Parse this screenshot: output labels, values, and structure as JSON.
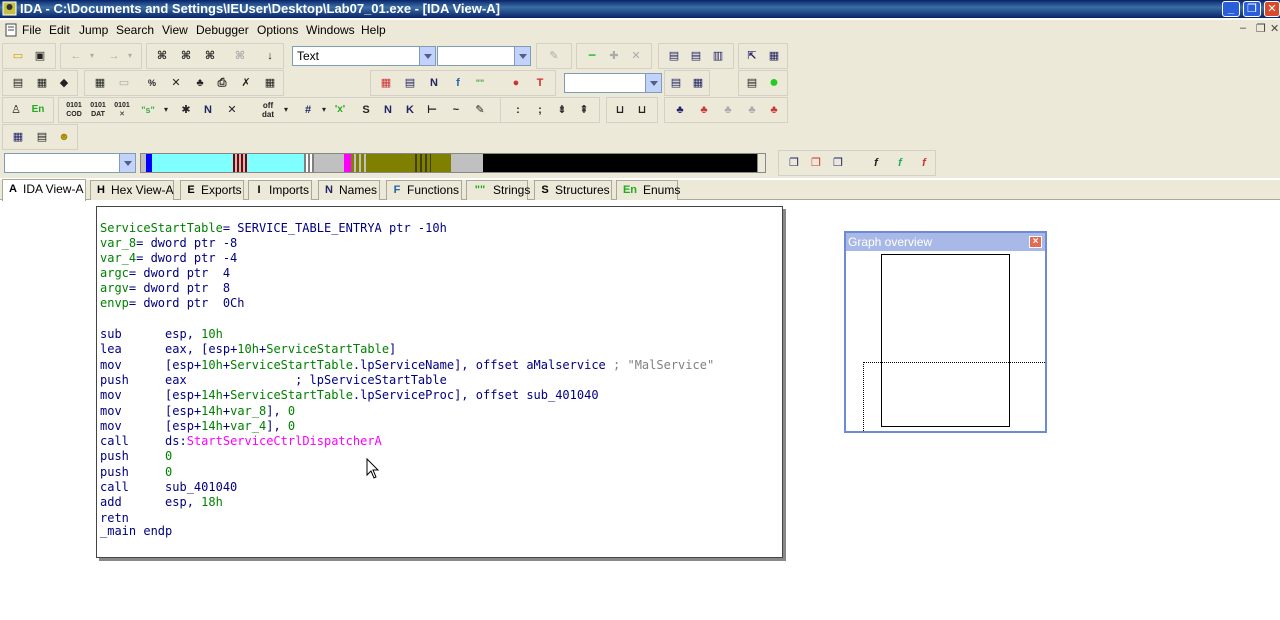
{
  "window": {
    "title": "IDA - C:\\Documents and Settings\\IEUser\\Desktop\\Lab07_01.exe - [IDA View-A]",
    "min_label": "_",
    "max_label": "❐",
    "close_label": "✕"
  },
  "menu": [
    "File",
    "Edit",
    "Jump",
    "Search",
    "View",
    "Debugger",
    "Options",
    "Windows",
    "Help"
  ],
  "menu_window_controls": [
    "–",
    "❐",
    "✕"
  ],
  "toolbar": {
    "display_combo": "Text",
    "second_combo": "",
    "third_combo": "",
    "segment_combo": ""
  },
  "tabs": [
    "IDA View-A",
    "Hex View-A",
    "Exports",
    "Imports",
    "Names",
    "Functions",
    "Strings",
    "Structures",
    "Enums"
  ],
  "tab_icons": [
    "A",
    "H",
    "E",
    "I",
    "N",
    "F",
    "\"\"",
    "S",
    "En"
  ],
  "navband_colors": {
    "cyan": "#7fffff",
    "darkred": "#800000",
    "gray": "#c0c0c0",
    "olive": "#808000",
    "magenta": "#ff00ff",
    "blue": "#0000ff",
    "black": "#000000"
  },
  "code": {
    "lines": [
      [
        "ServiceStartTable",
        "= ",
        "SERVICE_TABLE_ENTRYA ptr -10h"
      ],
      [
        "var_8",
        "= ",
        "dword ptr -8"
      ],
      [
        "var_4",
        "= ",
        "dword ptr -4"
      ],
      [
        "argc",
        "= ",
        "dword ptr  4"
      ],
      [
        "argv",
        "= ",
        "dword ptr  8"
      ],
      [
        "envp",
        "= ",
        "dword ptr  0Ch"
      ]
    ],
    "instructions": [
      {
        "mn": "sub",
        "op": "esp, 10h"
      },
      {
        "mn": "lea",
        "op": "eax, [esp+10h+ServiceStartTable]"
      },
      {
        "mn": "mov",
        "op": "[esp+10h+ServiceStartTable.lpServiceName], offset aMalservice",
        "cmt": "; \"MalService\""
      },
      {
        "mn": "push",
        "op": "eax",
        "cmt": "; lpServiceStartTable"
      },
      {
        "mn": "mov",
        "op": "[esp+14h+ServiceStartTable.lpServiceProc], offset sub_401040"
      },
      {
        "mn": "mov",
        "op": "[esp+14h+var_8], 0"
      },
      {
        "mn": "mov",
        "op": "[esp+14h+var_4], 0"
      },
      {
        "mn": "call",
        "op": "ds:StartServiceCtrlDispatcherA"
      },
      {
        "mn": "push",
        "op": "0"
      },
      {
        "mn": "push",
        "op": "0"
      },
      {
        "mn": "call",
        "op": "sub_401040"
      },
      {
        "mn": "add",
        "op": "esp, 18h"
      },
      {
        "mn": "retn",
        "op": ""
      }
    ],
    "endp": "_main endp"
  },
  "graph_overview": {
    "title": "Graph overview",
    "close": "×"
  }
}
